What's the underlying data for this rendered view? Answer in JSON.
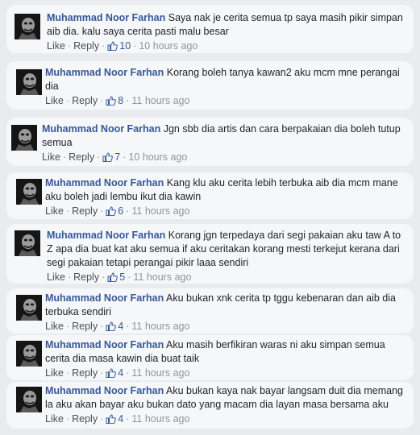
{
  "comments": [
    {
      "author": "Muhammad Noor Farhan",
      "text": "Saya nak je cerita semua tp saya masih pikir simpan aib dia. kalu saya cerita pasti malu besar",
      "like_label": "Like",
      "reply_label": "Reply",
      "likes": "10",
      "time": "10 hours ago"
    },
    {
      "author": "Muhammad Noor Farhan",
      "text": "Korang boleh tanya kawan2 aku mcm mne perangai dia",
      "like_label": "Like",
      "reply_label": "Reply",
      "likes": "8",
      "time": "11 hours ago"
    },
    {
      "author": "Muhammad Noor Farhan",
      "text": "Jgn sbb dia artis dan cara berpakaian dia boleh tutup semua",
      "like_label": "Like",
      "reply_label": "Reply",
      "likes": "7",
      "time": "10 hours ago"
    },
    {
      "author": "Muhammad Noor Farhan",
      "text": "Kang klu aku cerita lebih terbuka aib dia mcm mane aku boleh jadi lembu ikut dia kawin",
      "like_label": "Like",
      "reply_label": "Reply",
      "likes": "6",
      "time": "11 hours ago"
    },
    {
      "author": "Muhammad Noor Farhan",
      "text": "Korang jgn terpedaya dari segi pakaian aku taw A to Z apa dia buat kat aku semua if aku ceritakan korang mesti terkejut kerana dari segi pakaian tetapi perangai pikir laaa sendiri",
      "like_label": "Like",
      "reply_label": "Reply",
      "likes": "5",
      "time": "11 hours ago"
    },
    {
      "author": "Muhammad Noor Farhan",
      "text": "Aku bukan xnk cerita tp tggu kebenaran dan aib dia terbuka sendiri",
      "like_label": "Like",
      "reply_label": "Reply",
      "likes": "4",
      "time": "11 hours ago"
    },
    {
      "author": "Muhammad Noor Farhan",
      "text": "Aku masih berfikiran waras ni aku simpan semua cerita dia masa kawin dia buat taik",
      "like_label": "Like",
      "reply_label": "Reply",
      "likes": "4",
      "time": "11 hours ago"
    },
    {
      "author": "Muhammad Noor Farhan",
      "text": "Aku bukan kaya nak bayar langsam duit dia memang la aku akan bayar aku bukan dato yang macam dia layan masa bersama aku",
      "like_label": "Like",
      "reply_label": "Reply",
      "likes": "4",
      "time": "11 hours ago"
    }
  ],
  "colors": {
    "author_link": "#365899",
    "meta_gray": "#90949c",
    "bubble_bg": "#f6f7f9",
    "page_bg": "#e9ebee"
  },
  "icons": {
    "avatar": "dark-face-avatar",
    "like": "thumbs-up-icon"
  }
}
